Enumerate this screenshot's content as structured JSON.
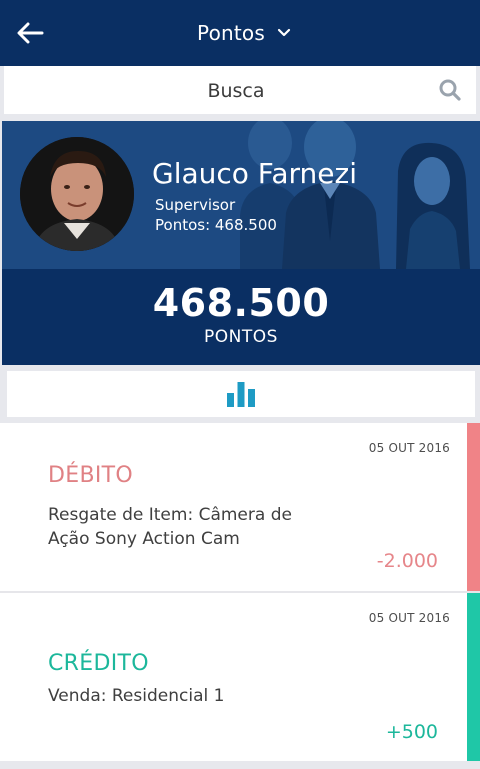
{
  "header": {
    "title": "Pontos"
  },
  "search": {
    "placeholder": "Busca"
  },
  "profile": {
    "name": "Glauco Farnezi",
    "role": "Supervisor",
    "points_line": "Pontos: 468.500"
  },
  "points": {
    "value": "468.500",
    "label": "PONTOS"
  },
  "transactions": [
    {
      "date": "05 OUT 2016",
      "type": "DÉBITO",
      "description": "Resgate de Item: Câmera de Ação Sony Action Cam",
      "amount": "-2.000",
      "color": "#f08387"
    },
    {
      "date": "05 OUT 2016",
      "type": "CRÉDITO",
      "description": "Venda: Residencial 1",
      "amount": "+500",
      "color": "#1fc7a7"
    }
  ],
  "icons": {
    "back": "arrow-left-icon",
    "dropdown": "chevron-down-icon",
    "search": "search-icon",
    "chart": "bar-chart-icon"
  },
  "colors": {
    "header": "#0a2f63",
    "banner": "#1d4a82",
    "chart_icon": "#1e9bc4",
    "debit": "#f08387",
    "credit": "#1fc7a7"
  }
}
